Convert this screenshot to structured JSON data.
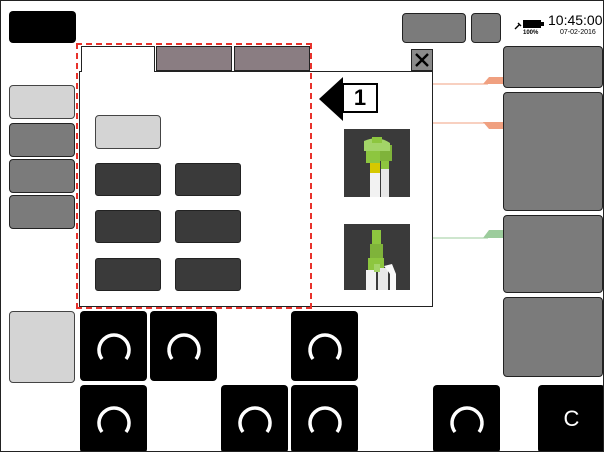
{
  "status": {
    "time": "10:45:00",
    "battery_pct": "100%",
    "date": "07-02-2016",
    "battery_icon": "battery-icon",
    "plug_icon": "plug-icon"
  },
  "dialog": {
    "close_icon": "close-icon",
    "tabs": [
      "",
      "",
      ""
    ],
    "active_tab": 0
  },
  "callout": {
    "number": "1",
    "arrow_icon": "left-arrow-icon"
  },
  "knobs": {
    "icon": "dial-icon",
    "c_label": "C"
  },
  "colors": {
    "highlight_red": "#e8322c",
    "accent_orange": "#f0a080",
    "accent_green": "#9ccc9c",
    "tool_green": "#8dc63f",
    "tool_yellow": "#d6c800"
  }
}
